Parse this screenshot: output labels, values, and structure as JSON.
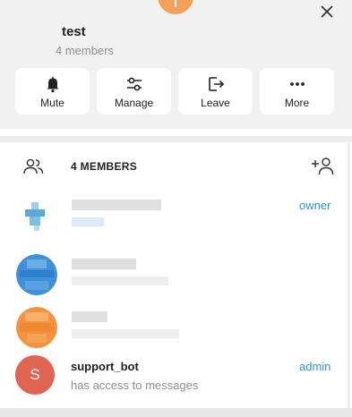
{
  "group": {
    "title": "test",
    "subtitle": "4 members"
  },
  "actions": [
    {
      "label": "Mute",
      "icon": "bell-icon"
    },
    {
      "label": "Manage",
      "icon": "sliders-icon"
    },
    {
      "label": "Leave",
      "icon": "leave-icon"
    },
    {
      "label": "More",
      "icon": "more-icon"
    }
  ],
  "members": {
    "title": "4 MEMBERS",
    "list": [
      {
        "role": "owner",
        "avatar_color": "#5aa9d8"
      },
      {
        "role": "",
        "avatar_color": "#3f8fd9"
      },
      {
        "role": "",
        "avatar_color": "#f39340"
      }
    ],
    "bot": {
      "initial": "S",
      "name": "support_bot",
      "status": "has access to messages",
      "role": "admin",
      "avatar_color": "#e06452"
    }
  },
  "colors": {
    "accent": "#2b95d6",
    "header_bg": "#f1f1f1"
  }
}
